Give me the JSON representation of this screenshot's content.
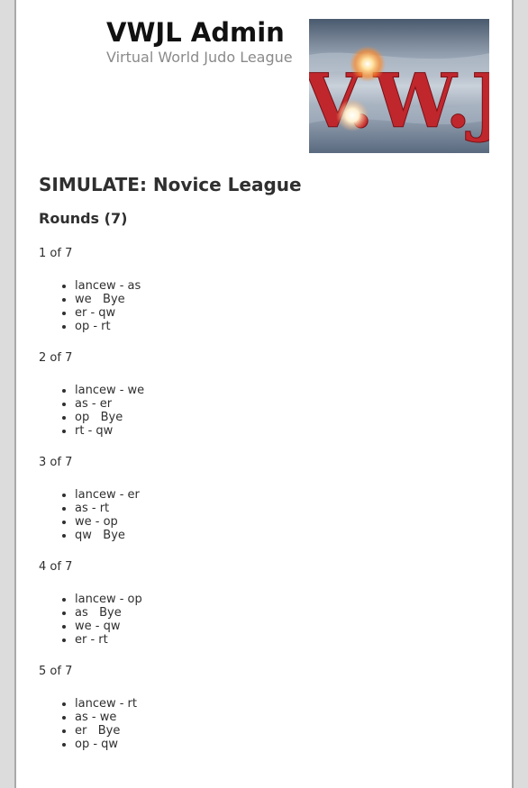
{
  "site": {
    "title": "VWJL Admin",
    "tagline": "Virtual World Judo League",
    "logo_text": "V.W.J.L."
  },
  "main": {
    "heading": "SIMULATE: Novice League",
    "rounds_heading": "Rounds (7)",
    "rounds": [
      {
        "label": "1 of 7",
        "matches": [
          "lancew - as",
          "we   Bye",
          "er - qw",
          "op - rt"
        ]
      },
      {
        "label": "2 of 7",
        "matches": [
          "lancew - we",
          "as - er",
          "op   Bye",
          "rt - qw"
        ]
      },
      {
        "label": "3 of 7",
        "matches": [
          "lancew - er",
          "as - rt",
          "we - op",
          "qw   Bye"
        ]
      },
      {
        "label": "4 of 7",
        "matches": [
          "lancew - op",
          "as   Bye",
          "we - qw",
          "er - rt"
        ]
      },
      {
        "label": "5 of 7",
        "matches": [
          "lancew - rt",
          "as - we",
          "er   Bye",
          "op - qw"
        ]
      }
    ]
  },
  "colors": {
    "page_background": "#dcdcdc",
    "content_background": "#ffffff",
    "logo_letters": "#c0272d"
  }
}
